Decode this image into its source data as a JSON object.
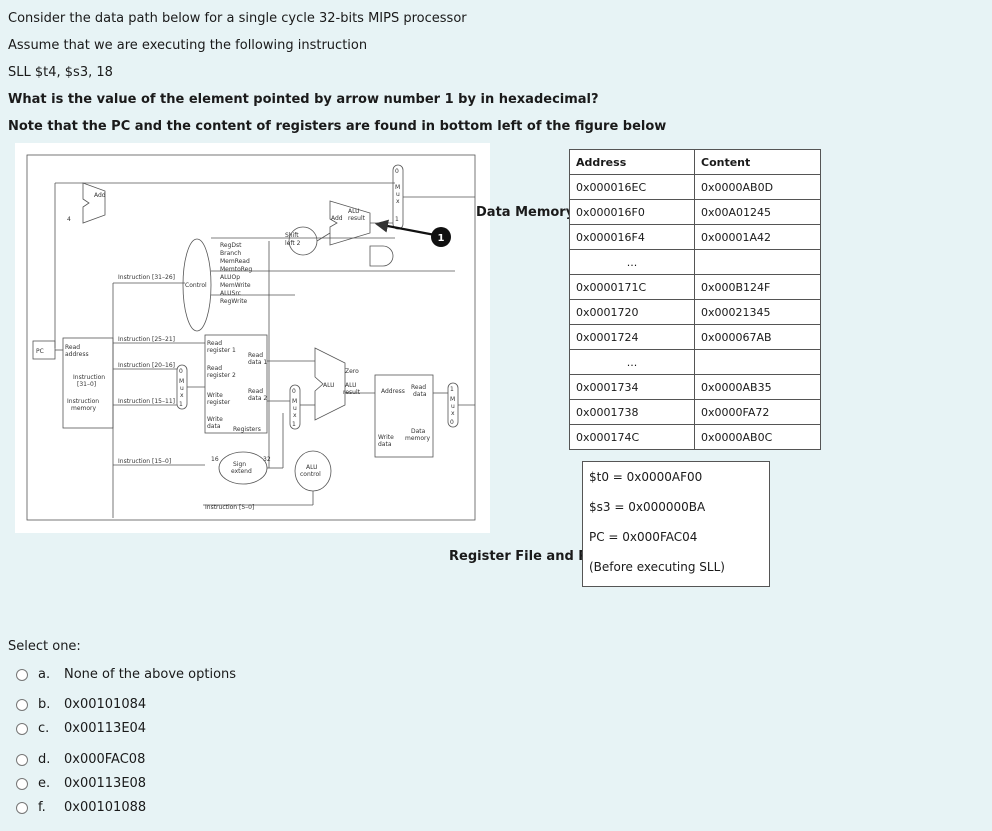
{
  "question": {
    "line1": "Consider the data path below for a single cycle 32-bits MIPS processor",
    "line2": "Assume that we are executing the following instruction",
    "instruction": "SLL $t4, $s3, 18",
    "prompt": "What is the value of the element pointed by arrow number 1 by in hexadecimal?",
    "note": "Note that the PC and the content of registers are found in bottom left of the figure below"
  },
  "figure": {
    "add_top": "Add",
    "four": "4",
    "mux_letters": [
      "M",
      "u",
      "x"
    ],
    "mux_zero": "0",
    "mux_one": "1",
    "add_alu": [
      "Add",
      "ALU",
      "result"
    ],
    "shift": [
      "Shift",
      "left 2"
    ],
    "arrow_number": "1",
    "control_signals": [
      "RegDst",
      "Branch",
      "MemRead",
      "MemtoReg",
      "ALUOp",
      "MemWrite",
      "ALUSrc",
      "RegWrite"
    ],
    "control": "Control",
    "instr_31_26": "Instruction [31–26]",
    "instr_25_21": "Instruction [25–21]",
    "instr_20_16": "Instruction [20–16]",
    "instr_15_11": "Instruction [15–11]",
    "instr_15_0": "Instruction [15–0]",
    "instr_5_0": "Instruction [5–0]",
    "pc": "PC",
    "read_address": [
      "Read",
      "address"
    ],
    "instruction_31_0": [
      "Instruction",
      "[31–0]"
    ],
    "instruction_memory": [
      "Instruction",
      "memory"
    ],
    "reg_labels": [
      "Read",
      "register 1",
      "Read",
      "register 2",
      "Write",
      "register",
      "Write",
      "data"
    ],
    "read_data1": [
      "Read",
      "data 1"
    ],
    "read_data2": [
      "Read",
      "data 2"
    ],
    "registers": "Registers",
    "zero": "Zero",
    "alu": [
      "ALU",
      "ALU",
      "result"
    ],
    "address": "Address",
    "read_data": [
      "Read",
      "data"
    ],
    "write_data": [
      "Write",
      "data"
    ],
    "data_memory": [
      "Data",
      "memory"
    ],
    "sign_extend": [
      "Sign",
      "extend"
    ],
    "n16": "16",
    "n32": "32",
    "alu_control": [
      "ALU",
      "control"
    ]
  },
  "data_memory_label": "Data Memory",
  "memory_table": {
    "header": [
      "Address",
      "Content"
    ],
    "rows": [
      [
        "0x000016EC",
        "0x0000AB0D"
      ],
      [
        "0x000016F0",
        "0x00A01245"
      ],
      [
        "0x000016F4",
        "0x00001A42"
      ],
      [
        "...",
        ""
      ],
      [
        "0x0000171C",
        "0x000B124F"
      ],
      [
        "0x0001720",
        "0x00021345"
      ],
      [
        "0x0001724",
        "0x000067AB"
      ],
      [
        "...",
        ""
      ],
      [
        "0x0001734",
        "0x0000AB35"
      ],
      [
        "0x0001738",
        "0x0000FA72"
      ],
      [
        "0x000174C",
        "0x0000AB0C"
      ]
    ]
  },
  "register_label": "Register File and PC",
  "registers": [
    "$t0 = 0x0000AF00",
    "$s3 = 0x000000BA",
    "PC = 0x000FAC04",
    "(Before executing SLL)"
  ],
  "select_one": "Select one:",
  "options": [
    {
      "letter": "a.",
      "text": "None of the above options"
    },
    {
      "letter": "b.",
      "text": "0x00101084"
    },
    {
      "letter": "c.",
      "text": "0x00113E04"
    },
    {
      "letter": "d.",
      "text": "0x000FAC08"
    },
    {
      "letter": "e.",
      "text": "0x00113E08"
    },
    {
      "letter": "f.",
      "text": "0x00101088"
    }
  ]
}
